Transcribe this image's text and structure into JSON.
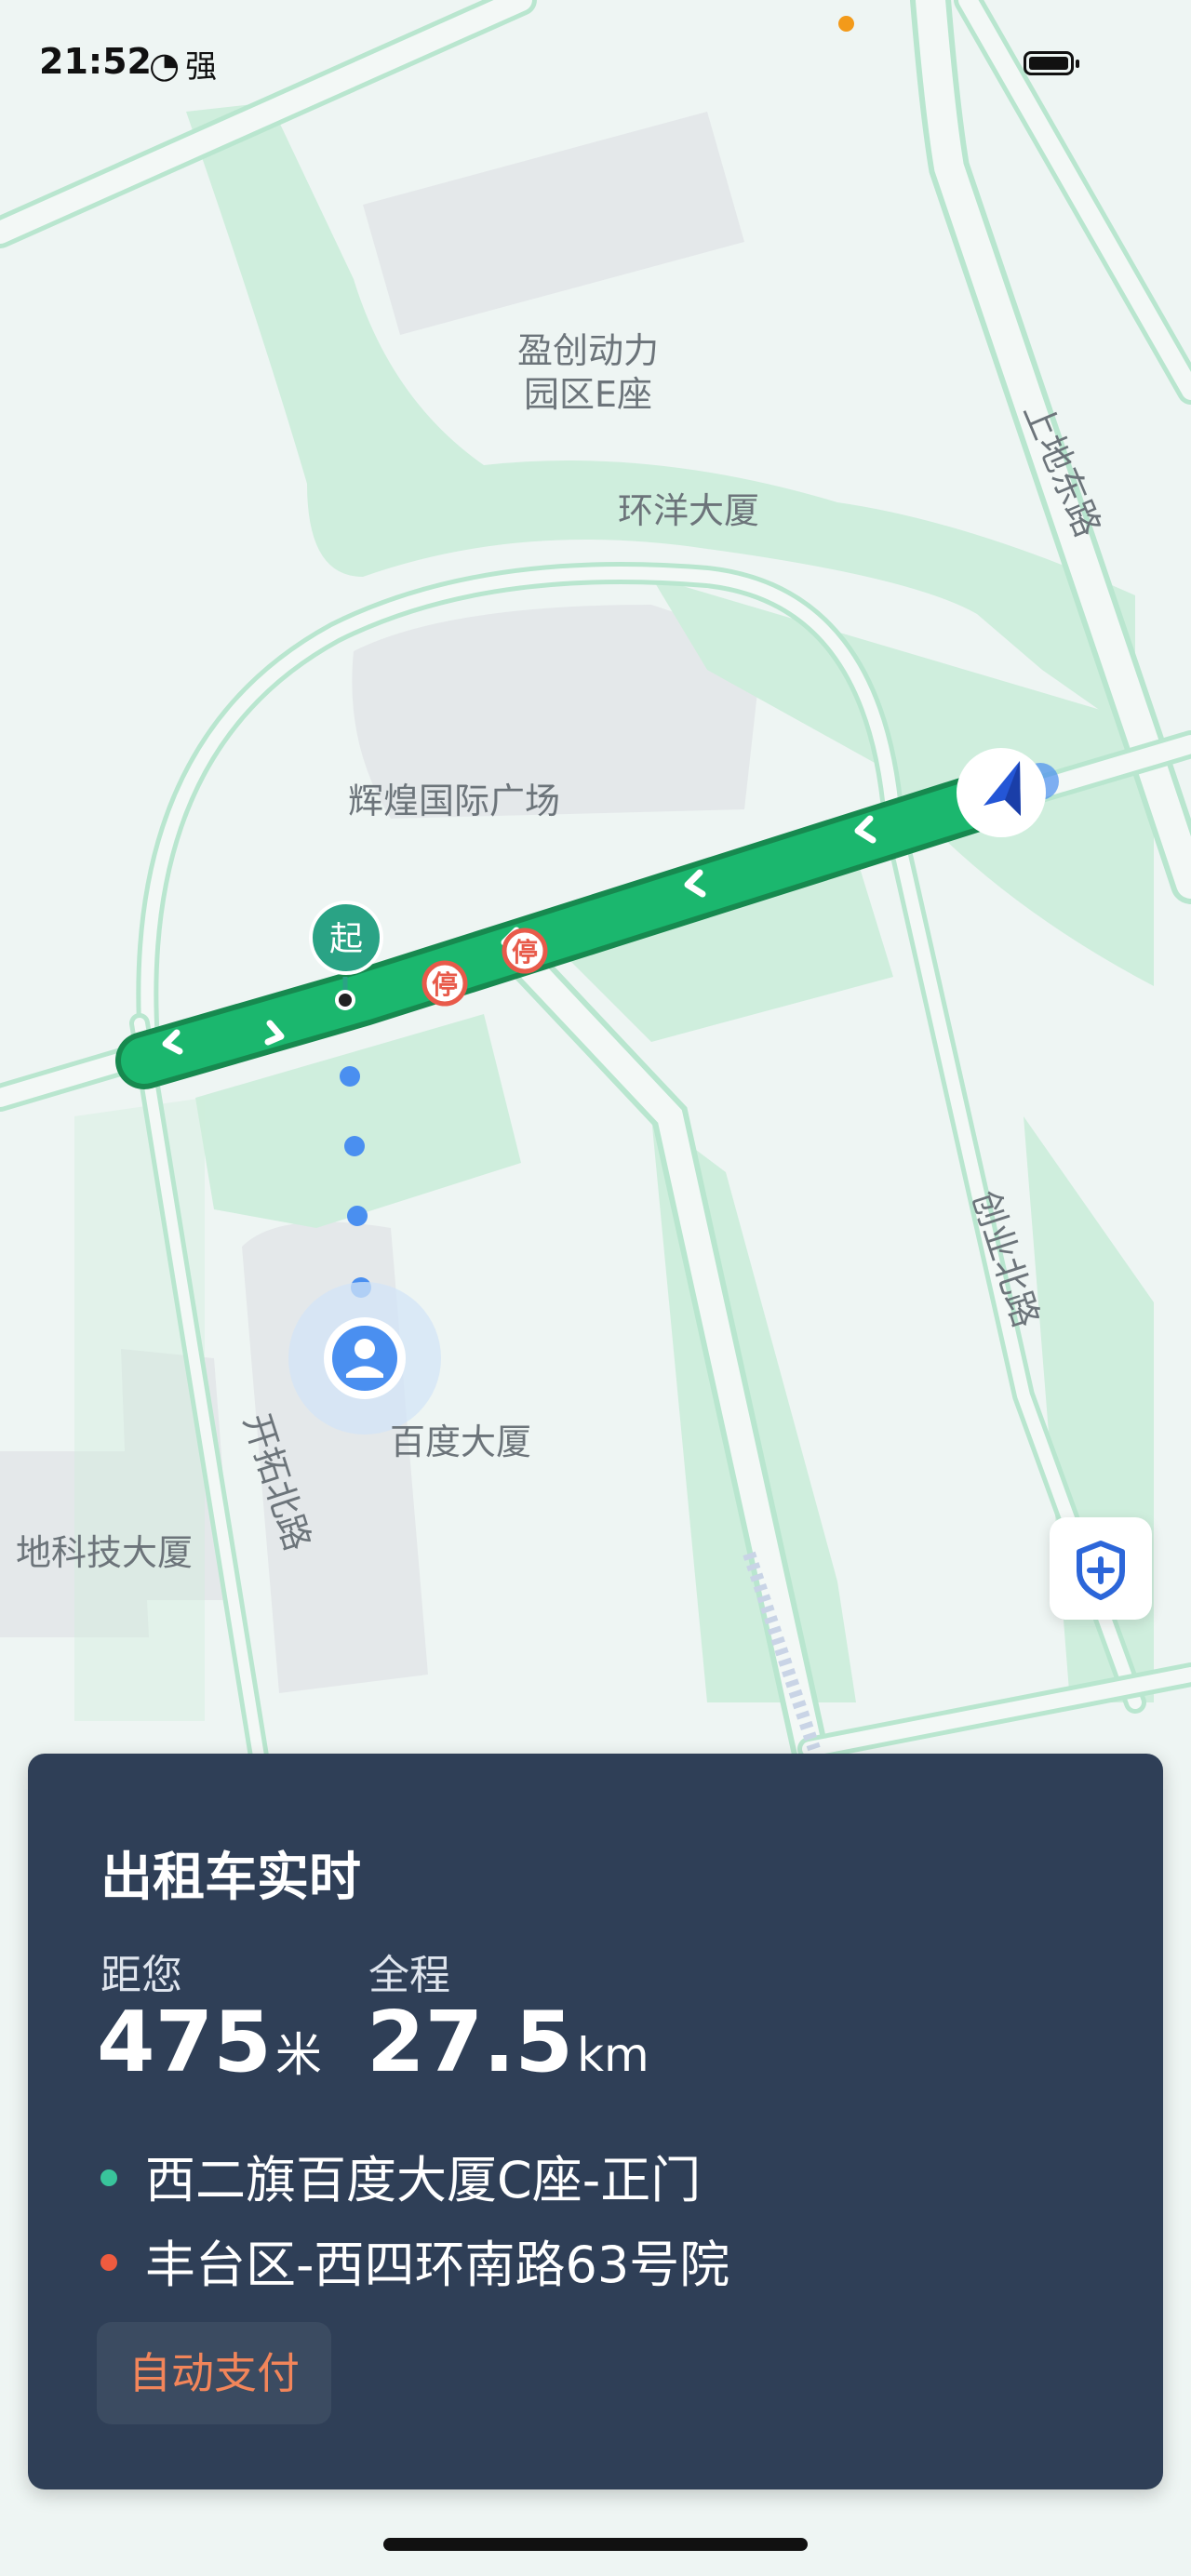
{
  "status_bar": {
    "time": "21:52",
    "signal_symbol": "◔",
    "signal_label": "强"
  },
  "map": {
    "labels": {
      "building_1_line1": "盈创动力",
      "building_1_line2": "园区E座",
      "huanyang": "环洋大厦",
      "huihuang": "辉煌国际广场",
      "baidu": "百度大厦",
      "tech": "地科技大厦",
      "road_shangdi_east": "上地东路",
      "road_chuangye_north": "创业北路",
      "road_kaituo_north": "开拓北路"
    },
    "start_marker": "起",
    "stop_sign": "停",
    "colors": {
      "route": "#1bb76e",
      "user": "#4a8ff0",
      "start": "#2aa385"
    }
  },
  "trip_panel": {
    "title": "出租车实时",
    "distance_label": "距您",
    "distance_value": "475",
    "distance_unit": "米",
    "total_label": "全程",
    "total_value": "27.5",
    "total_unit": "km",
    "origin": "西二旗百度大厦C座-正门",
    "destination": "丰台区-西四环南路63号院",
    "origin_color": "#39c49b",
    "destination_color": "#ef5b3f",
    "pay_button": "自动支付"
  },
  "icons": {
    "shield": "shield-plus-icon",
    "car": "navigation-arrow-icon",
    "user": "user-avatar-icon"
  }
}
